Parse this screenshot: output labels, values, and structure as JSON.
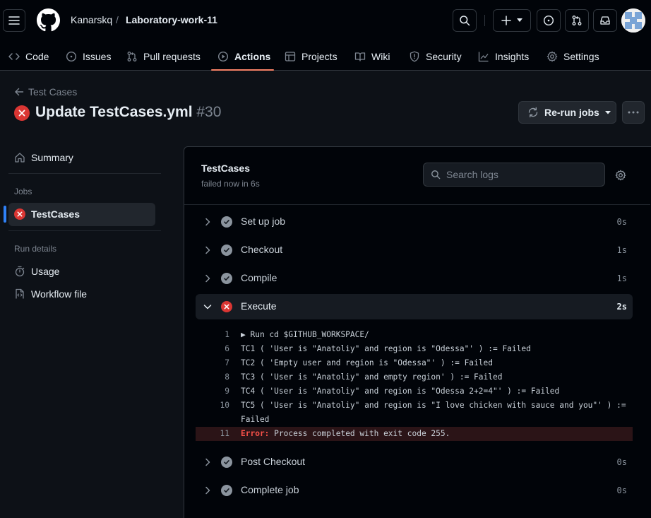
{
  "header": {
    "owner": "Kanarskq",
    "separator": "/",
    "repo": "Laboratory-work-11"
  },
  "nav": {
    "tabs": [
      {
        "label": "Code",
        "icon": "code-icon"
      },
      {
        "label": "Issues",
        "icon": "issue-icon"
      },
      {
        "label": "Pull requests",
        "icon": "pull-request-icon"
      },
      {
        "label": "Actions",
        "icon": "play-icon",
        "active": true
      },
      {
        "label": "Projects",
        "icon": "table-icon"
      },
      {
        "label": "Wiki",
        "icon": "book-icon"
      },
      {
        "label": "Security",
        "icon": "shield-icon"
      },
      {
        "label": "Insights",
        "icon": "graph-icon"
      },
      {
        "label": "Settings",
        "icon": "gear-icon"
      }
    ]
  },
  "run": {
    "back_label": "Test Cases",
    "title": "Update TestCases.yml",
    "number": "#30",
    "rerun_label": "Re-run jobs"
  },
  "sidebar": {
    "summary": "Summary",
    "jobs_heading": "Jobs",
    "job": "TestCases",
    "run_details_heading": "Run details",
    "usage": "Usage",
    "workflow_file": "Workflow file"
  },
  "job": {
    "name": "TestCases",
    "status": "failed now in 6s",
    "search_placeholder": "Search logs"
  },
  "steps_before": [
    {
      "label": "Set up job",
      "duration": "0s"
    },
    {
      "label": "Checkout",
      "duration": "1s"
    },
    {
      "label": "Compile",
      "duration": "1s"
    }
  ],
  "expanded_step": {
    "label": "Execute",
    "duration": "2s"
  },
  "log_lines": [
    {
      "n": "1",
      "text": "▶ Run cd $GITHUB_WORKSPACE/"
    },
    {
      "n": "6",
      "text": "TC1 ( 'User is \"Anatoliy\" and region is \"Odessa\"' ) := Failed"
    },
    {
      "n": "7",
      "text": "TC2 ( 'Empty user and region is \"Odessa\"' ) := Failed"
    },
    {
      "n": "8",
      "text": "TC3 ( 'User is \"Anatoliy\" and empty region' ) := Failed"
    },
    {
      "n": "9",
      "text": "TC4 ( 'User is \"Anatoliy\" and region is \"Odessa 2+2=4\"' ) := Failed"
    },
    {
      "n": "10",
      "text": "TC5 ( 'User is \"Anatoliy\" and region is \"I love chicken with sauce and you\"' ) :="
    },
    {
      "n": "",
      "text": "Failed"
    }
  ],
  "error_line": {
    "n": "11",
    "label": "Error:",
    "text": " Process completed with exit code 255."
  },
  "steps_after": [
    {
      "label": "Post Checkout",
      "duration": "0s"
    },
    {
      "label": "Complete job",
      "duration": "0s"
    }
  ],
  "colors": {
    "failure": "#da3633",
    "success_gray": "#8b949e",
    "accent_underline": "#f78166",
    "active_bar": "#2f81f7"
  }
}
